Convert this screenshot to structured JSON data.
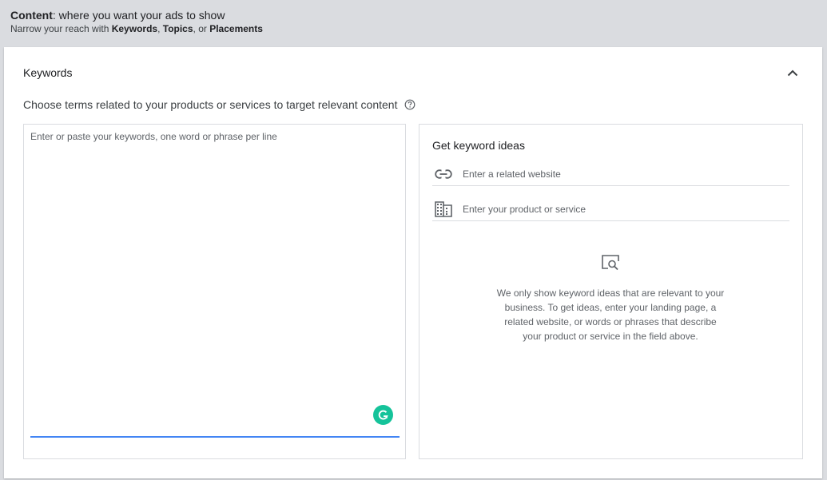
{
  "header": {
    "title_bold": "Content",
    "title_rest": ": where you want your ads to show",
    "subtitle_prefix": "Narrow your reach with ",
    "subtitle_keywords": "Keywords",
    "subtitle_sep1": ", ",
    "subtitle_topics": "Topics",
    "subtitle_sep2": ", or ",
    "subtitle_placements": "Placements"
  },
  "keywords_section": {
    "title": "Keywords",
    "description": "Choose terms related to your products or services to target relevant content",
    "textarea_placeholder": "Enter or paste your keywords, one word or phrase per line",
    "textarea_value": ""
  },
  "ideas": {
    "title": "Get keyword ideas",
    "website_placeholder": "Enter a related website",
    "product_placeholder": "Enter your product or service",
    "empty_message": "We only show keyword ideas that are relevant to your business. To get ideas, enter your landing page, a related website, or words or phrases that describe your product or service in the field above."
  },
  "icons": {
    "collapse": "chevron-up-icon",
    "help": "help-circle-icon",
    "link": "link-icon",
    "business": "building-icon",
    "search_illustration": "search-page-icon",
    "grammarly": "grammarly-icon"
  },
  "colors": {
    "accent_blue": "#4285f4",
    "grammarly_green": "#15c39a",
    "header_bg": "#dadce0"
  }
}
